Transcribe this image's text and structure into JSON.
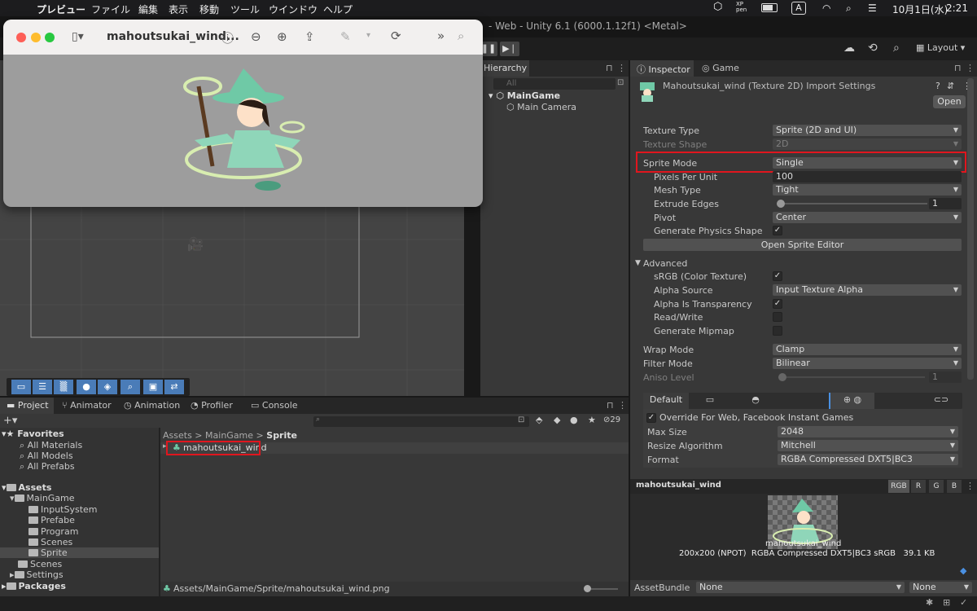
{
  "menubar": {
    "apple": "",
    "app": "プレビュー",
    "items": [
      "ファイル",
      "編集",
      "表示",
      "移動",
      "ツール",
      "ウインドウ",
      "ヘルプ"
    ],
    "xp": "XP\npen",
    "input": "A",
    "date": "10月1日(水)",
    "time": "2:21"
  },
  "unity_title": "- Web - Unity 6.1 (6000.1.12f1) <Metal>",
  "toolbar": {
    "layout": "Layout"
  },
  "preview_window": {
    "title": "mahoutsukai_wind..."
  },
  "hierarchy": {
    "tab": "Hierarchy",
    "search_placeholder": "All",
    "scene": "MainGame",
    "camera": "Main Camera"
  },
  "inspector": {
    "tabs": [
      "Inspector",
      "Game"
    ],
    "header_title": "Mahoutsukai_wind (Texture 2D) Import Settings",
    "open": "Open",
    "rows": [
      {
        "label": "Texture Type",
        "value": "Sprite (2D and UI)"
      },
      {
        "label": "Texture Shape",
        "value": "2D"
      },
      {
        "label": "Sprite Mode",
        "value": "Single"
      },
      {
        "label": "Pixels Per Unit",
        "value": "100"
      },
      {
        "label": "Mesh Type",
        "value": "Tight"
      },
      {
        "label": "Extrude Edges",
        "value": "1"
      },
      {
        "label": "Pivot",
        "value": "Center"
      },
      {
        "label": "Generate Physics Shape",
        "value": "✓"
      }
    ],
    "open_sprite_editor": "Open Sprite Editor",
    "advanced": "Advanced",
    "adv_rows": [
      {
        "label": "sRGB (Color Texture)",
        "value": "✓"
      },
      {
        "label": "Alpha Source",
        "value": "Input Texture Alpha"
      },
      {
        "label": "Alpha Is Transparency",
        "value": "✓"
      },
      {
        "label": "Read/Write",
        "value": ""
      },
      {
        "label": "Generate Mipmap",
        "value": ""
      }
    ],
    "wrap_mode": {
      "label": "Wrap Mode",
      "value": "Clamp"
    },
    "filter_mode": {
      "label": "Filter Mode",
      "value": "Bilinear"
    },
    "aniso": {
      "label": "Aniso Level",
      "value": "1"
    },
    "platform_default": "Default",
    "override": "Override For Web, Facebook Instant Games",
    "max_size": {
      "label": "Max Size",
      "value": "2048"
    },
    "resize": {
      "label": "Resize Algorithm",
      "value": "Mitchell"
    },
    "format": {
      "label": "Format",
      "value": "RGBA Compressed DXT5|BC3"
    }
  },
  "preview_panel": {
    "name": "mahoutsukai_wind",
    "channels": [
      "RGB",
      "R",
      "G",
      "B"
    ],
    "img_name": "mahoutsukai_wind",
    "info": "200x200 (NPOT)  RGBA Compressed DXT5|BC3 sRGB   39.1 KB"
  },
  "assetbundle": {
    "label": "AssetBundle",
    "v1": "None",
    "v2": "None"
  },
  "project": {
    "tabs": [
      "Project",
      "Animator",
      "Animation",
      "Profiler",
      "Console"
    ],
    "count": "29",
    "favorites": "Favorites",
    "fav_items": [
      "All Materials",
      "All Models",
      "All Prefabs"
    ],
    "assets": "Assets",
    "maingame": "MainGame",
    "sub_folders": [
      "InputSystem",
      "Prefabe",
      "Program",
      "Scenes",
      "Sprite"
    ],
    "root_folders": [
      "Scenes",
      "Settings"
    ],
    "packages": "Packages",
    "breadcrumb": [
      "Assets",
      "MainGame",
      "Sprite"
    ],
    "asset_item": "mahoutsukai_wind",
    "path": "Assets/MainGame/Sprite/mahoutsukai_wind.png"
  }
}
